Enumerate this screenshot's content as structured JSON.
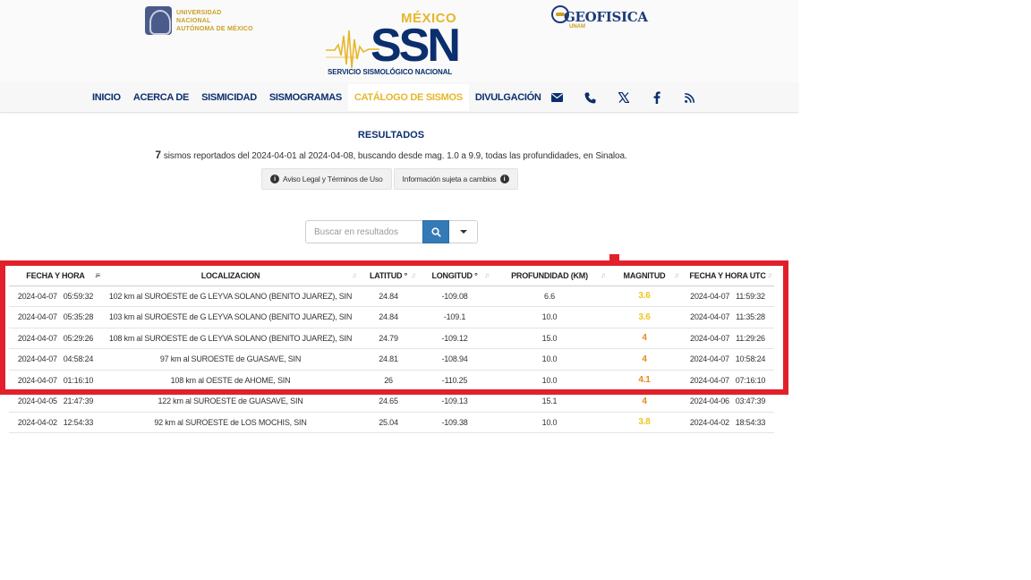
{
  "header": {
    "unam_line1": "UNIVERSIDAD NACIONAL",
    "unam_line2": "AUTÓNOMA DE MÉXICO",
    "ssn_country": "MÉXICO",
    "ssn_acronym": "SSN",
    "ssn_name": "SERVICIO SISMOLÓGICO NACIONAL",
    "geo_name": "GEOFISICA",
    "geo_sub": "UNAM"
  },
  "nav": {
    "items": [
      {
        "label": "INICIO"
      },
      {
        "label": "ACERCA DE"
      },
      {
        "label": "SISMICIDAD"
      },
      {
        "label": "SISMOGRAMAS"
      },
      {
        "label": "CATÁLOGO DE SISMOS",
        "active": true
      },
      {
        "label": "DIVULGACIÓN"
      }
    ],
    "icons": [
      "envelope-icon",
      "phone-icon",
      "x-twitter-icon",
      "facebook-icon",
      "rss-icon"
    ]
  },
  "results": {
    "title": "RESULTADOS",
    "count": "7",
    "summary": "sismos reportados del 2024-04-01 al 2024-04-08, buscando desde mag. 1.0 a 9.9, todas las profundidades, en Sinaloa.",
    "legal_label": "Aviso Legal y Términos de Uso",
    "changes_label": "Información sujeta a cambios"
  },
  "search": {
    "placeholder": "Buscar en resultados"
  },
  "table": {
    "headers": {
      "fecha": "FECHA Y HORA",
      "loc": "LOCALIZACION",
      "lat": "LATITUD °",
      "lon": "LONGITUD °",
      "prof": "PROFUNDIDAD (KM)",
      "mag": "MAGNITUD",
      "utc": "FECHA Y HORA UTC"
    },
    "rows": [
      {
        "fecha": "2024-04-07   05:59:32",
        "loc": "102 km al SUROESTE de G LEYVA SOLANO (BENITO JUAREZ), SIN",
        "lat": "24.84",
        "lon": "-109.08",
        "prof": "6.6",
        "mag": "3.6",
        "utc": "2024-04-07   11:59:32"
      },
      {
        "fecha": "2024-04-07   05:35:28",
        "loc": "103 km al SUROESTE de G LEYVA SOLANO (BENITO JUAREZ), SIN",
        "lat": "24.84",
        "lon": "-109.1",
        "prof": "10.0",
        "mag": "3.6",
        "utc": "2024-04-07   11:35:28"
      },
      {
        "fecha": "2024-04-07   05:29:26",
        "loc": "108 km al SUROESTE de G LEYVA SOLANO (BENITO JUAREZ), SIN",
        "lat": "24.79",
        "lon": "-109.12",
        "prof": "15.0",
        "mag": "4",
        "utc": "2024-04-07   11:29:26"
      },
      {
        "fecha": "2024-04-07   04:58:24",
        "loc": "97 km al SUROESTE de GUASAVE, SIN",
        "lat": "24.81",
        "lon": "-108.94",
        "prof": "10.0",
        "mag": "4",
        "utc": "2024-04-07   10:58:24"
      },
      {
        "fecha": "2024-04-07   01:16:10",
        "loc": "108 km al OESTE de AHOME, SIN",
        "lat": "26",
        "lon": "-110.25",
        "prof": "10.0",
        "mag": "4.1",
        "utc": "2024-04-07   07:16:10"
      },
      {
        "fecha": "2024-04-05   21:47:39",
        "loc": "122 km al SUROESTE de GUASAVE, SIN",
        "lat": "24.65",
        "lon": "-109.13",
        "prof": "15.1",
        "mag": "4",
        "utc": "2024-04-06   03:47:39"
      },
      {
        "fecha": "2024-04-02   12:54:33",
        "loc": "92 km al SUROESTE de LOS MOCHIS, SIN",
        "lat": "25.04",
        "lon": "-109.38",
        "prof": "10.0",
        "mag": "3.8",
        "utc": "2024-04-02   18:54:33"
      }
    ]
  },
  "colors": {
    "brand_blue": "#0b2f6e",
    "brand_gold": "#e6b72b",
    "mag_low": "#f0c419",
    "mag_high": "#e8891c",
    "highlight_red": "#e2202c"
  }
}
